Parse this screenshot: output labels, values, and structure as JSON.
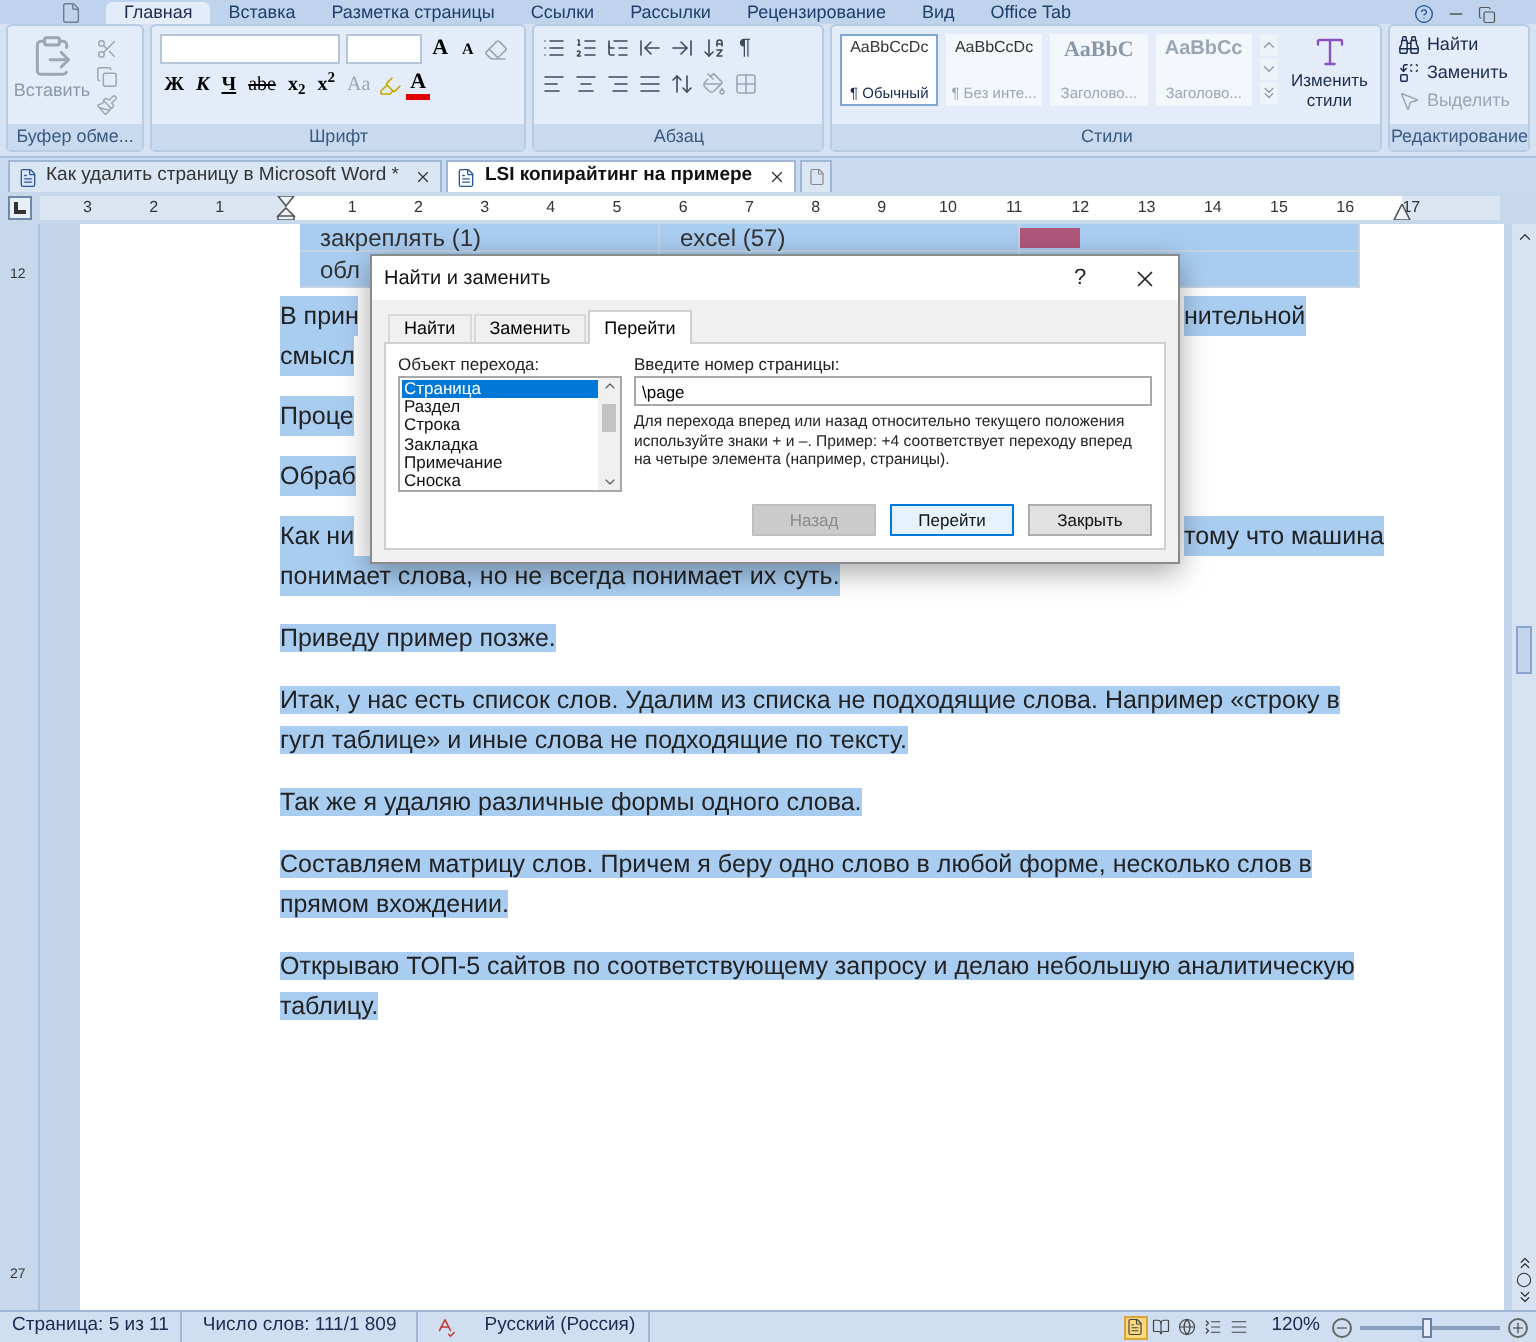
{
  "ribbon_tabs": [
    {
      "label": "Главная",
      "selected": true
    },
    {
      "label": "Вставка",
      "selected": false
    },
    {
      "label": "Разметка страницы",
      "selected": false
    },
    {
      "label": "Ссылки",
      "selected": false
    },
    {
      "label": "Рассылки",
      "selected": false
    },
    {
      "label": "Рецензирование",
      "selected": false
    },
    {
      "label": "Вид",
      "selected": false
    },
    {
      "label": "Office Tab",
      "selected": false
    }
  ],
  "ribbon": {
    "clipboard": {
      "paste_label": "Вставить",
      "group_label": "Буфер обме..."
    },
    "font": {
      "grow": "A",
      "shrink": "A",
      "buttons": [
        {
          "kind": "bold",
          "label": "Ж"
        },
        {
          "kind": "italic",
          "label": "К"
        },
        {
          "kind": "underline",
          "label": "Ч"
        },
        {
          "kind": "strike",
          "label": "abe"
        },
        {
          "kind": "sub",
          "label": "x$_{2}$"
        },
        {
          "kind": "sup",
          "label": "x$^{2}$"
        },
        {
          "kind": "case",
          "label": "Aa"
        }
      ],
      "font_color": "A",
      "group_label": "Шрифт"
    },
    "paragraph": {
      "pilcrow": "¶",
      "group_label": "Абзац"
    },
    "styles": {
      "items": [
        {
          "preview": "AaBbCcDc",
          "name": "¶ Обычный",
          "kind": "normal",
          "selected": true
        },
        {
          "preview": "AaBbCcDc",
          "name": "¶ Без инте...",
          "kind": "normal",
          "selected": false
        },
        {
          "preview": "AaBbC",
          "name": "Заголово...",
          "kind": "heading",
          "selected": false
        },
        {
          "preview": "AaBbCc",
          "name": "Заголово...",
          "kind": "subheading",
          "selected": false
        }
      ],
      "change_styles": "Изменить стили",
      "group_label": "Стили"
    },
    "editing": {
      "items": [
        {
          "kind": "find",
          "label": "Найти",
          "disabled": false
        },
        {
          "kind": "replace",
          "label": "Заменить",
          "disabled": false
        },
        {
          "kind": "select",
          "label": "Выделить",
          "disabled": true
        }
      ],
      "group_label": "Редактирование"
    }
  },
  "document_tabs": [
    {
      "title": "Как удалить страницу в Microsoft Word *",
      "selected": false
    },
    {
      "title": "LSI копирайтинг на примере",
      "selected": true
    }
  ],
  "ruler": {
    "left_marks": [
      "3",
      "2",
      "1"
    ],
    "right_marks": [
      "1",
      "2",
      "3",
      "4",
      "5",
      "6",
      "7",
      "8",
      "9",
      "10",
      "11",
      "12",
      "13",
      "14",
      "15",
      "16",
      "17"
    ]
  },
  "vertical_ruler": {
    "marks": [
      "12",
      "27"
    ]
  },
  "document": {
    "table_rows": [
      [
        "закреплять (1)",
        "excel (57)"
      ],
      [
        "обл"
      ]
    ],
    "partial_paragraphs": [
      {
        "lines": [
          {
            "left": "В прин",
            "right": "нительной"
          },
          {
            "left": "смысл"
          }
        ]
      },
      {
        "lines": [
          {
            "left": "Проце"
          }
        ]
      },
      {
        "lines": [
          {
            "left": "Обраб"
          }
        ]
      },
      {
        "lines": [
          {
            "left": "Как ни",
            "right": "тому что машина"
          },
          {
            "left": "понимает слова, но не всегда понимает их суть."
          }
        ]
      }
    ],
    "paragraphs": [
      "Приведу пример позже.",
      "Итак, у нас есть список слов. Удалим из списка не подходящие слова. Например «строку в гугл таблице» и иные слова не подходящие по тексту.",
      "Так же я удаляю различные формы одного слова.",
      "Составляем матрицу слов. Причем я беру одно слово в любой форме, несколько слов в прямом вхождении.",
      "Открываю ТОП-5 сайтов по соответствующему запросу и делаю небольшую аналитическую таблицу."
    ]
  },
  "dialog": {
    "title": "Найти и заменить",
    "help": "?",
    "tabs": [
      {
        "label": "Найти",
        "selected": false
      },
      {
        "label": "Заменить",
        "selected": false
      },
      {
        "label": "Перейти",
        "selected": true
      }
    ],
    "list_label": "Объект перехода:",
    "list": [
      {
        "label": "Страница",
        "selected": true
      },
      {
        "label": "Раздел",
        "selected": false
      },
      {
        "label": "Строка",
        "selected": false
      },
      {
        "label": "Закладка",
        "selected": false
      },
      {
        "label": "Примечание",
        "selected": false
      },
      {
        "label": "Сноска",
        "selected": false
      }
    ],
    "input_label": "Введите номер страницы:",
    "input_value": "\\page",
    "hint": "Для перехода вперед или назад относительно текущего положения используйте знаки + и –. Пример: +4 соответствует переходу вперед на четыре элемента (например, страницы).",
    "buttons": [
      {
        "label": "Назад",
        "disabled": true,
        "default": false
      },
      {
        "label": "Перейти",
        "disabled": false,
        "default": true
      },
      {
        "label": "Закрыть",
        "disabled": false,
        "default": false
      }
    ]
  },
  "status_bar": {
    "page": "Страница: 5 из 11",
    "words": "Число слов: 111/1 809",
    "language": "Русский (Россия)",
    "views": [
      {
        "kind": "print",
        "selected": true
      },
      {
        "kind": "reading",
        "selected": false
      },
      {
        "kind": "web",
        "selected": false
      },
      {
        "kind": "outline",
        "selected": false
      },
      {
        "kind": "draft",
        "selected": false
      }
    ],
    "zoom": "120%",
    "zoom_level": {
      "level": 0.47
    }
  }
}
